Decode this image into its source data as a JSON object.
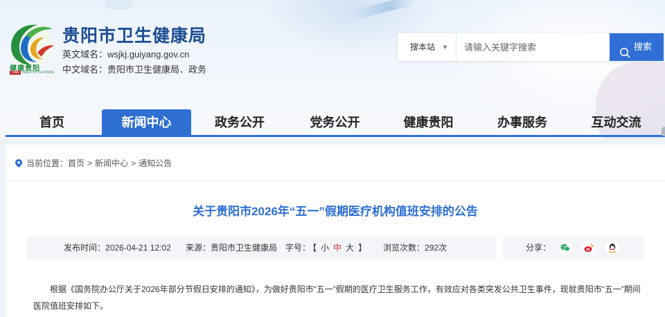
{
  "site": {
    "title": "贵阳市卫生健康局",
    "domain_en_label": "英文域名：",
    "domain_en_value": "wsjkj.guiyang.gov.cn",
    "domain_cn_label": "中文域名：",
    "domain_cn_value": "贵阳市卫生健康局．政务",
    "logo_text_cn": "健康贵阳",
    "logo_text_en_tag": "YIAN",
    "logo_text_en": "HEALTHY GUIYANG"
  },
  "search": {
    "scope_label": "搜本站",
    "placeholder": "请输入关键字搜索",
    "button_label": "搜索"
  },
  "nav": {
    "items": [
      {
        "label": "首页",
        "active": false
      },
      {
        "label": "新闻中心",
        "active": true
      },
      {
        "label": "政务公开",
        "active": false
      },
      {
        "label": "党务公开",
        "active": false
      },
      {
        "label": "健康贵阳",
        "active": false
      },
      {
        "label": "办事服务",
        "active": false
      },
      {
        "label": "互动交流",
        "active": false
      }
    ]
  },
  "breadcrumb": {
    "prefix": "当前位置：",
    "items": [
      "首页",
      "新闻中心",
      "通知公告"
    ],
    "separator": ">"
  },
  "article": {
    "title": "关于贵阳市2026年“五一”假期医疗机构值班安排的公告",
    "publish_label": "发布时间：",
    "publish_time": "2026-04-21 12:02",
    "source_label": "来源：",
    "source": "贵阳市卫生健康局",
    "font_label": "字号：",
    "font_open": "【",
    "font_small": "小",
    "font_medium": "中",
    "font_large": "大",
    "font_close": "】",
    "views_label": "浏览次数：",
    "views": "292次",
    "share_label": "分享：",
    "body_paragraph": "根据《国务院办公厅关于2026年部分节假日安排的通知》，为做好贵阳市“五一”假期的医疗卫生服务工作，有效应对各类突发公共卫生事件，现就贵阳市“五一”期间医院值班安排如下。"
  },
  "colors": {
    "brand_blue": "#2e6fd2",
    "title_blue": "#1d4d92",
    "highlight_red": "#d5312a",
    "wechat_green": "#2aae67",
    "weibo_red": "#e6162d"
  },
  "icons": {
    "share": [
      "wechat-icon",
      "weibo-icon",
      "qq-icon"
    ],
    "breadcrumb": "location-pin-icon",
    "search": "search-icon"
  }
}
